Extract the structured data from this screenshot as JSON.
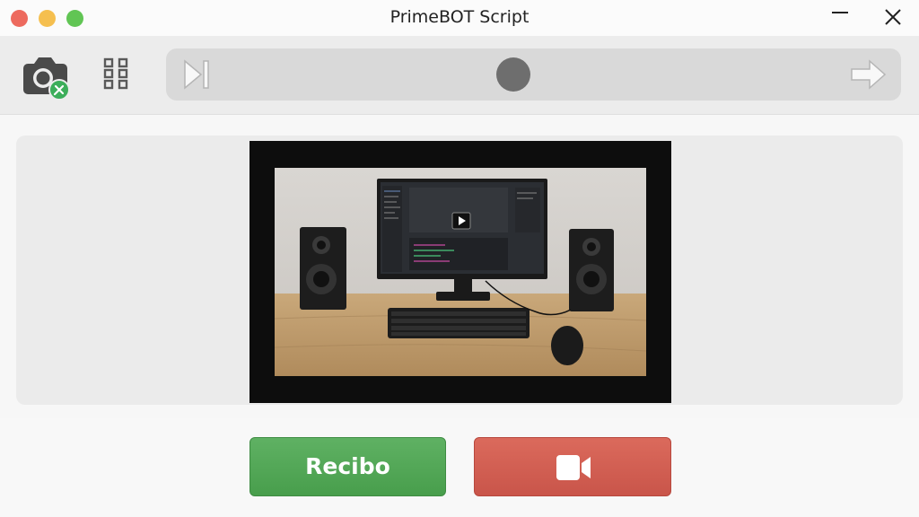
{
  "window": {
    "title": "PrimeBOT Script"
  },
  "toolbar": {
    "camera_settings_icon": "camera-with-settings-badge",
    "grid_icon": "grid-icon",
    "playbar": {
      "skip_icon": "skip-to-end-icon",
      "record_indicator": "record-dot",
      "forward_icon": "forward-arrow-icon"
    }
  },
  "preview": {
    "play_icon": "play-icon"
  },
  "actions": {
    "recibo_label": "Recibo",
    "video_icon": "video-camera-icon"
  },
  "colors": {
    "accent_green": "#4fa653",
    "accent_red": "#d15f53",
    "toolbar_bg": "#ececec",
    "playbar_bg": "#d9d9d9"
  }
}
